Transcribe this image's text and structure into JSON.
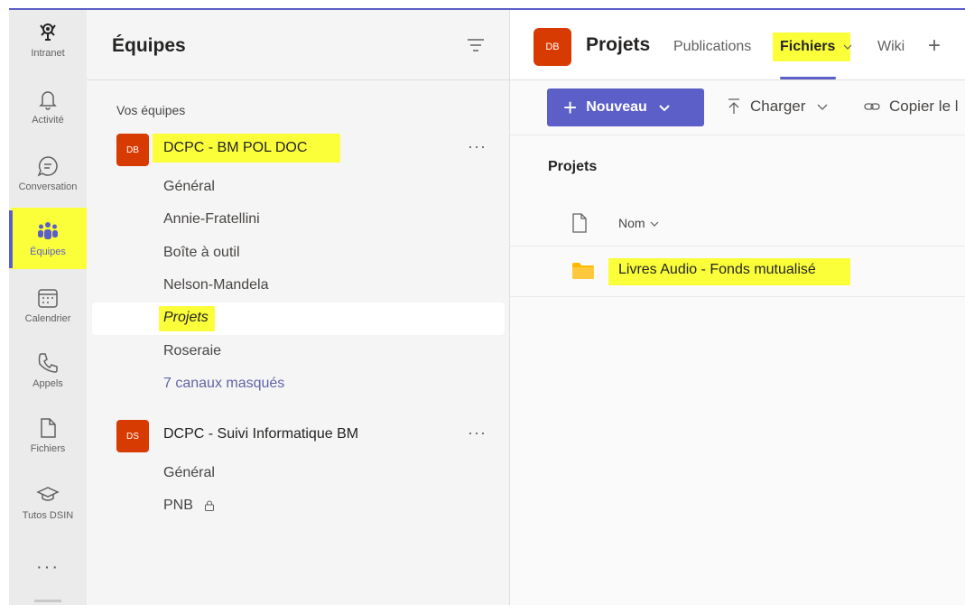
{
  "rail": {
    "items": [
      {
        "label": "Intranet",
        "icon": "intranet-icon"
      },
      {
        "label": "Activité",
        "icon": "bell-icon"
      },
      {
        "label": "Conversation",
        "icon": "chat-icon"
      },
      {
        "label": "Équipes",
        "icon": "teams-icon"
      },
      {
        "label": "Calendrier",
        "icon": "calendar-icon"
      },
      {
        "label": "Appels",
        "icon": "phone-icon"
      },
      {
        "label": "Fichiers",
        "icon": "file-icon"
      },
      {
        "label": "Tutos DSIN",
        "icon": "graduation-cap-icon"
      }
    ],
    "more": "···",
    "accent_color": "#5b5fc7"
  },
  "teams_panel": {
    "title": "Équipes",
    "section_label": "Vos équipes",
    "teams": [
      {
        "avatar": "DB",
        "name": "DCPC - BM POL DOC",
        "more": "···",
        "channels": [
          "Général",
          "Annie-Fratellini",
          "Boîte à outil",
          "Nelson-Mandela",
          "Projets",
          "Roseraie"
        ],
        "hidden_channels": "7 canaux masqués"
      },
      {
        "avatar": "DS",
        "name": "DCPC - Suivi Informatique BM",
        "more": "···",
        "channels": [
          "Général",
          "PNB"
        ]
      }
    ]
  },
  "main": {
    "avatar": "DB",
    "channel_title": "Projets",
    "tabs": [
      "Publications",
      "Fichiers",
      "Wiki"
    ],
    "active_tab": "Fichiers",
    "add_tab": "+",
    "toolbar": {
      "new_label": "Nouveau",
      "upload_label": "Charger",
      "copy_link_label": "Copier le l"
    },
    "breadcrumb": "Projets",
    "list": {
      "column_name": "Nom",
      "files": [
        {
          "name": "Livres Audio - Fonds mutualisé",
          "type": "folder"
        }
      ]
    }
  },
  "colors": {
    "highlight": "#fbff3a",
    "team_avatar": "#d83b01",
    "folder": "#ffb900"
  }
}
